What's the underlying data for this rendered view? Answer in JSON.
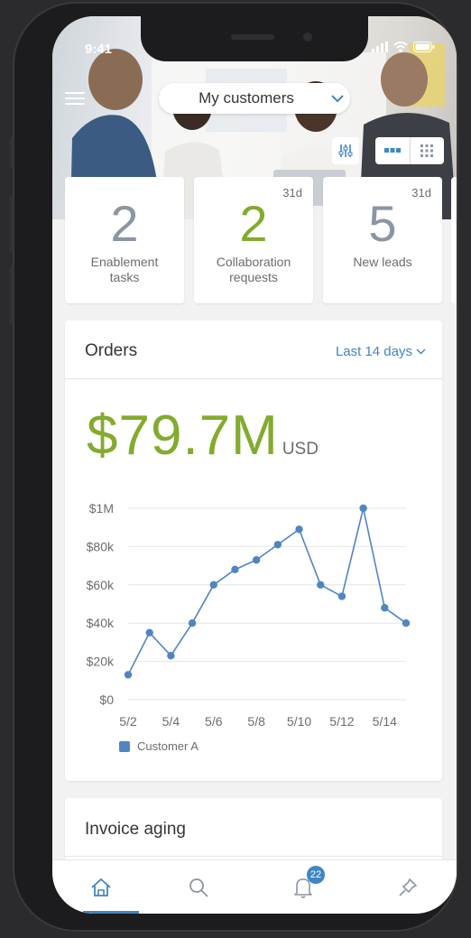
{
  "status_bar": {
    "time": "9:41"
  },
  "header": {
    "selector_label": "My customers"
  },
  "tiles": [
    {
      "value": "2",
      "label_line1": "Enablement",
      "label_line2": "tasks",
      "badge": ""
    },
    {
      "value": "2",
      "label_line1": "Collaboration",
      "label_line2": "requests",
      "badge": "31d"
    },
    {
      "value": "5",
      "label_line1": "New leads",
      "label_line2": "",
      "badge": "31d"
    }
  ],
  "orders": {
    "title": "Orders",
    "period": "Last 14 days",
    "total": "$79.7M",
    "unit": "USD"
  },
  "chart_data": {
    "type": "line",
    "y_tick_labels": [
      "$1M",
      "$80k",
      "$60k",
      "$40k",
      "$20k",
      "$0"
    ],
    "x_tick_labels": [
      "5/2",
      "5/4",
      "5/6",
      "5/8",
      "5/10",
      "5/12",
      "5/14"
    ],
    "ylim": [
      0,
      100
    ],
    "grid": true,
    "legend_position": "bottom-left",
    "series": [
      {
        "name": "Customer A",
        "color": "#5085c4",
        "x": [
          2,
          3,
          4,
          5,
          6,
          7,
          8,
          9,
          10,
          11,
          12,
          13,
          14,
          15
        ],
        "values": [
          13,
          35,
          23,
          40,
          60,
          68,
          73,
          81,
          89,
          60,
          54,
          100,
          48,
          40
        ]
      }
    ]
  },
  "invoice": {
    "title": "Invoice aging"
  },
  "tabbar": {
    "items": [
      "home",
      "search",
      "notifications",
      "pins"
    ],
    "notification_count": "22"
  },
  "colors": {
    "accent": "#3f86c4",
    "kpi_green": "#83ab2e",
    "kpi_grey": "#8a96a3"
  }
}
